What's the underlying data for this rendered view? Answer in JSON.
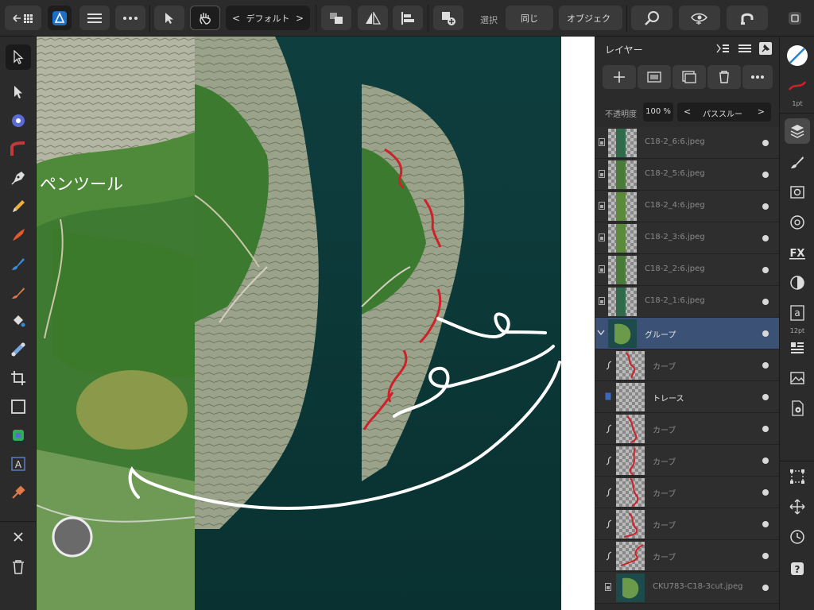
{
  "toolbar": {
    "back_icon": "back-grid-icon",
    "persona_icon": "designer-persona-icon",
    "menu_icon": "hamburger-menu-icon",
    "more_icon": "more-dots-icon",
    "move_tool_icon": "pointer-icon",
    "hand_tool_icon": "hand-icon",
    "style_prev": "<",
    "style_value": "デフォルト",
    "style_next": ">",
    "select_label": "選択",
    "same_label": "同じ",
    "object_label": "オブジェク"
  },
  "canvas": {
    "annotation_text": "ペンツール"
  },
  "layers": {
    "title": "レイヤー",
    "opacity_label": "不透明度",
    "opacity_value": "100 %",
    "blend_prev": "<",
    "blend_mode": "パススルー",
    "blend_next": ">",
    "items": [
      {
        "name": "C18-2_6:6.jpeg",
        "kind": "image"
      },
      {
        "name": "C18-2_5:6.jpeg",
        "kind": "image"
      },
      {
        "name": "C18-2_4:6.jpeg",
        "kind": "image"
      },
      {
        "name": "C18-2_3:6.jpeg",
        "kind": "image"
      },
      {
        "name": "C18-2_2:6.jpeg",
        "kind": "image"
      },
      {
        "name": "C18-2_1:6.jpeg",
        "kind": "image"
      },
      {
        "name": "グループ",
        "kind": "group"
      },
      {
        "name": "カーブ",
        "kind": "curve"
      },
      {
        "name": "トレース",
        "kind": "pixel"
      },
      {
        "name": "カーブ",
        "kind": "curve"
      },
      {
        "name": "カーブ",
        "kind": "curve"
      },
      {
        "name": "カーブ",
        "kind": "curve"
      },
      {
        "name": "カーブ",
        "kind": "curve"
      },
      {
        "name": "カーブ",
        "kind": "curve"
      },
      {
        "name": "CKU783-C18-3cut.jpeg",
        "kind": "image"
      }
    ]
  },
  "studio": {
    "stroke_width": "1pt",
    "font_size": "12pt"
  },
  "colors": {
    "selected_row": "#3b5276",
    "stroke_red": "#d0202a",
    "accent_blue": "#2a7fd4"
  }
}
